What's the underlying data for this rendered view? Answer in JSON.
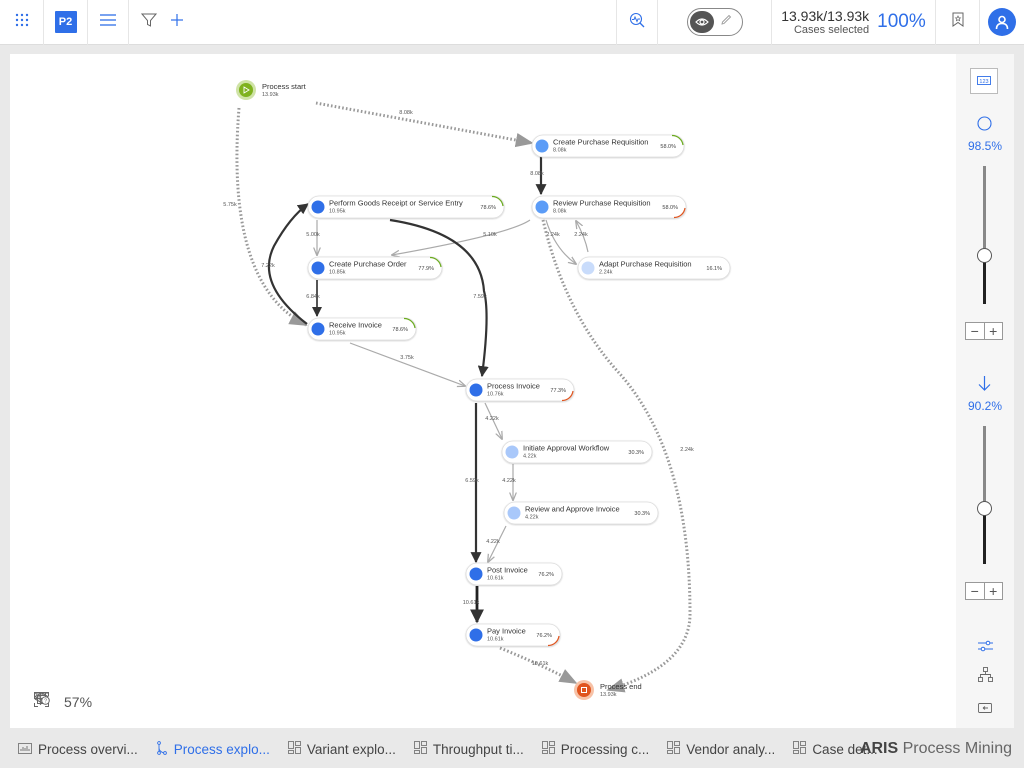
{
  "topbar": {
    "apps_icon": "apps-grid-icon",
    "project_badge": "P2",
    "menu_icon": "hamburger-menu-icon",
    "filter_icon": "filter-icon",
    "add_icon": "plus-icon",
    "analyze_icon": "analysis-icon",
    "view_mode_icon": "eye-icon",
    "edit_mode_icon": "pencil-icon",
    "cases_count": "13.93k/13.93k",
    "cases_label": "Cases selected",
    "cases_percent": "100%",
    "bookmark_icon": "bookmark-icon",
    "user_icon": "user-icon"
  },
  "graph": {
    "nodes": [
      {
        "id": "start",
        "label": "Process start",
        "count": "13.93k",
        "type": "start"
      },
      {
        "id": "cpr",
        "label": "Create Purchase Requisition",
        "count": "8.08k",
        "pct": "58.0%",
        "color": "#5b9cf7",
        "arc": "#6aab1d"
      },
      {
        "id": "rpr",
        "label": "Review Purchase Requisition",
        "count": "8.08k",
        "pct": "58.0%",
        "color": "#5b9cf7",
        "arc": "#e0541e"
      },
      {
        "id": "apr",
        "label": "Adapt Purchase Requisition",
        "count": "2.24k",
        "pct": "16.1%",
        "color": "#c9dcfb",
        "arc": null
      },
      {
        "id": "pgr",
        "label": "Perform Goods Receipt or Service Entry",
        "count": "10.95k",
        "pct": "78.6%",
        "color": "#2f6fe8",
        "arc": "#6aab1d"
      },
      {
        "id": "cpo",
        "label": "Create Purchase Order",
        "count": "10.85k",
        "pct": "77.9%",
        "color": "#2f6fe8",
        "arc": "#6aab1d"
      },
      {
        "id": "ri",
        "label": "Receive Invoice",
        "count": "10.95k",
        "pct": "78.6%",
        "color": "#2f6fe8",
        "arc": "#6aab1d"
      },
      {
        "id": "pi",
        "label": "Process Invoice",
        "count": "10.76k",
        "pct": "77.3%",
        "color": "#2f6fe8",
        "arc": "#e0541e"
      },
      {
        "id": "iaw",
        "label": "Initiate Approval Workflow",
        "count": "4.22k",
        "pct": "30.3%",
        "color": "#a9c8fa",
        "arc": null
      },
      {
        "id": "rai",
        "label": "Review and Approve Invoice",
        "count": "4.22k",
        "pct": "30.3%",
        "color": "#a9c8fa",
        "arc": null
      },
      {
        "id": "post",
        "label": "Post Invoice",
        "count": "10.61k",
        "pct": "76.2%",
        "color": "#2f6fe8",
        "arc": null
      },
      {
        "id": "pay",
        "label": "Pay Invoice",
        "count": "10.61k",
        "pct": "76.2%",
        "color": "#2f6fe8",
        "arc": "#e0541e"
      },
      {
        "id": "end",
        "label": "Process end",
        "count": "13.93k",
        "type": "end"
      }
    ],
    "edges": [
      {
        "from": "start",
        "to": "cpr",
        "label": "8.08k",
        "style": "dotted"
      },
      {
        "from": "start",
        "to": "ri",
        "label": "5.75k",
        "style": "dotted"
      },
      {
        "from": "cpr",
        "to": "rpr",
        "label": "8.08k",
        "style": "strong"
      },
      {
        "from": "rpr",
        "to": "cpo",
        "label": "5.10k",
        "style": "light"
      },
      {
        "from": "rpr",
        "to": "apr",
        "label": "2.24k",
        "style": "light"
      },
      {
        "from": "apr",
        "to": "rpr",
        "label": "2.24k",
        "style": "light"
      },
      {
        "from": "rpr",
        "to": "end",
        "label": "2.24k",
        "style": "dotted"
      },
      {
        "from": "pgr",
        "to": "cpo",
        "label": "5.00k",
        "style": "light"
      },
      {
        "from": "pgr",
        "to": "pi",
        "label": "7.59k",
        "style": "strong"
      },
      {
        "from": "cpo",
        "to": "ri",
        "label": "6.84k",
        "style": "medium"
      },
      {
        "from": "ri",
        "to": "pgr",
        "label": "7.22k",
        "style": "strong"
      },
      {
        "from": "ri",
        "to": "pi",
        "label": "3.75k",
        "style": "light"
      },
      {
        "from": "pi",
        "to": "iaw",
        "label": "4.22k",
        "style": "light"
      },
      {
        "from": "pi",
        "to": "post",
        "label": "6.59k",
        "style": "strong"
      },
      {
        "from": "iaw",
        "to": "rai",
        "label": "4.22k",
        "style": "light"
      },
      {
        "from": "rai",
        "to": "post",
        "label": "4.22k",
        "style": "light"
      },
      {
        "from": "post",
        "to": "pay",
        "label": "10.61k",
        "style": "heavy"
      },
      {
        "from": "pay",
        "to": "end",
        "label": "10.61k",
        "style": "dotted"
      }
    ]
  },
  "right_panel": {
    "count_view_icon": "number-badge-icon",
    "activities_icon": "circle-icon",
    "activities_percent": "98.5%",
    "activities_slider_value": 0.35,
    "connections_icon": "arrow-down-icon",
    "connections_percent": "90.2%",
    "connections_slider_value": 0.4,
    "minus": "−",
    "plus": "+",
    "settings_icon": "sliders-icon",
    "layout_icon": "hierarchy-icon",
    "present_icon": "presentation-icon"
  },
  "zoom_bar": {
    "zoom_out": "−",
    "zoom_level": "57%",
    "zoom_in": "+",
    "fit_icon": "fit-to-screen-icon",
    "layers_icon": "layers-icon",
    "legend_icon": "legend-help-icon"
  },
  "tabs": [
    {
      "label": "Process overvi...",
      "icon": "chart-icon",
      "active": false
    },
    {
      "label": "Process explo...",
      "icon": "process-flow-icon",
      "active": true
    },
    {
      "label": "Variant explo...",
      "icon": "dashboard-icon",
      "active": false
    },
    {
      "label": "Throughput ti...",
      "icon": "dashboard-icon",
      "active": false
    },
    {
      "label": "Processing c...",
      "icon": "dashboard-icon",
      "active": false
    },
    {
      "label": "Vendor analy...",
      "icon": "dashboard-icon",
      "active": false
    },
    {
      "label": "Case det...",
      "icon": "dashboard-icon",
      "active": false
    }
  ],
  "brand": {
    "bold": "ARIS",
    "rest": " Process Mining"
  }
}
